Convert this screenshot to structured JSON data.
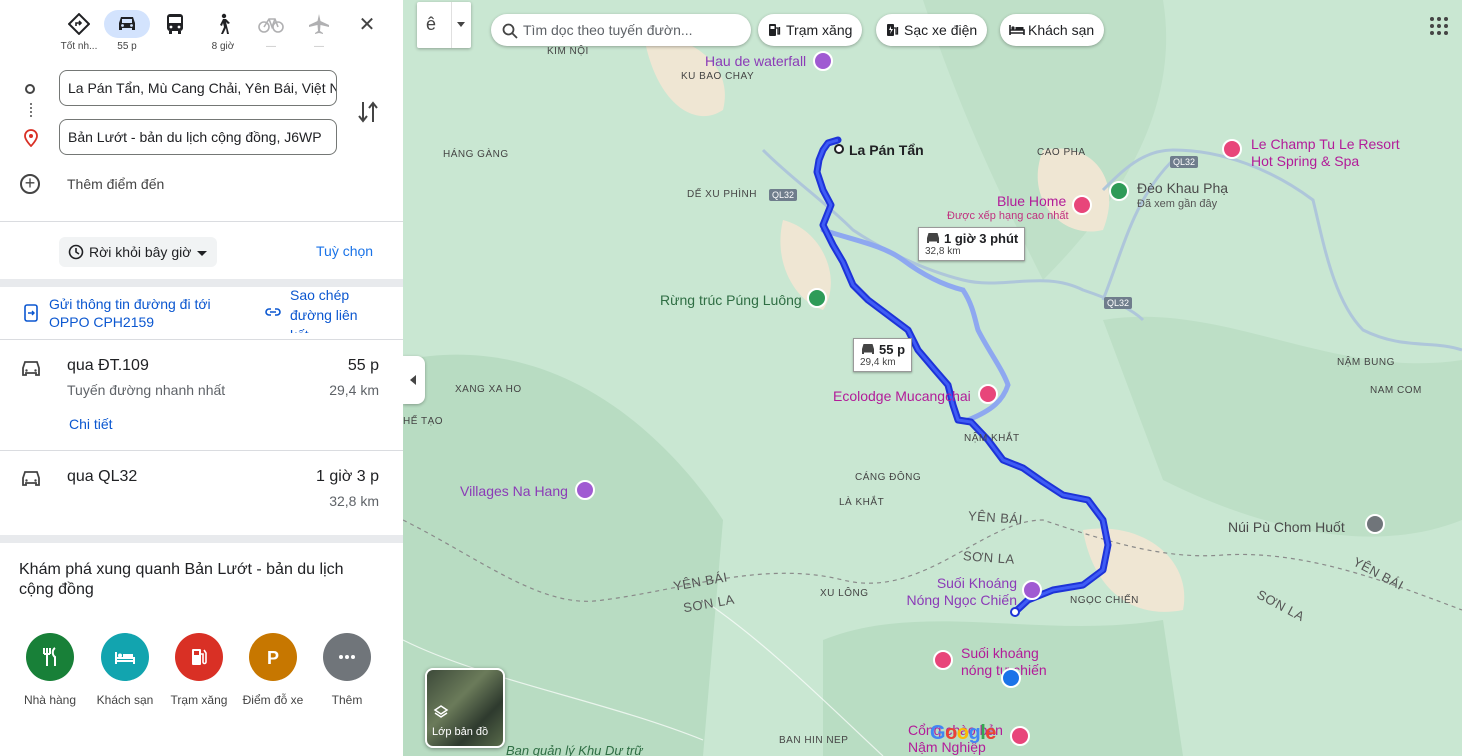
{
  "travel_modes": [
    {
      "name": "best",
      "sub": "Tốt nh...",
      "icon": "diamond-route-icon"
    },
    {
      "name": "driving",
      "sub": "55 p",
      "icon": "car-icon",
      "active": true
    },
    {
      "name": "transit",
      "sub": "",
      "icon": "bus-icon"
    },
    {
      "name": "walking",
      "sub": "8 giờ",
      "icon": "walking-icon"
    },
    {
      "name": "cycling",
      "sub": "—",
      "icon": "bike-icon"
    },
    {
      "name": "flight",
      "sub": "—",
      "icon": "plane-icon"
    }
  ],
  "origin": "La Pán Tẩn, Mù Cang Chải, Yên Bái, Việt Nam",
  "destination": "Bản Lướt - bản du lịch cộng đồng, J6WP",
  "add_destination": "Thêm điểm đến",
  "depart_label": "Rời khỏi bây giờ",
  "options_label": "Tuỳ chọn",
  "send_to_phone": "Gửi thông tin đường đi tới OPPO CPH2159",
  "copy_link": "Sao chép đường liên kết",
  "routes": [
    {
      "via": "qua ĐT.109",
      "note": "Tuyến đường nhanh nhất",
      "duration": "55 p",
      "distance": "29,4 km",
      "details": "Chi tiết"
    },
    {
      "via": "qua QL32",
      "duration": "1 giờ 3 p",
      "distance": "32,8 km"
    }
  ],
  "explore_title": "Khám phá xung quanh Bản Lướt - bản du lịch cộng đồng",
  "categories": [
    {
      "label": "Nhà hàng",
      "color": "#188038",
      "icon": "restaurant-icon"
    },
    {
      "label": "Khách sạn",
      "color": "#12a4af",
      "icon": "hotel-icon"
    },
    {
      "label": "Trạm xăng",
      "color": "#d93025",
      "icon": "gas-station-icon"
    },
    {
      "label": "Điểm đỗ xe",
      "color": "#c77700",
      "icon": "parking-icon"
    },
    {
      "label": "Thêm",
      "color": "#70757a",
      "icon": "more-icon"
    }
  ],
  "map": {
    "search_placeholder": "Tìm dọc theo tuyến đườn...",
    "lang_glyph": "ê",
    "chips": [
      "Trạm xăng",
      "Sạc xe điện",
      "Khách sạn"
    ],
    "start_label": "La Pán Tẩn",
    "route_boxes": [
      {
        "time": "1 giờ 3 phút",
        "distance": "32,8 km"
      },
      {
        "time": "55 p",
        "distance": "29,4 km"
      }
    ],
    "places": [
      "KIM NỘI",
      "KU BAO CHAY",
      "HÁNG GÀNG",
      "DẾ XU PHÌNH",
      "CAO PHA",
      "XANG XA HO",
      "HẾ TẠO",
      "NẬM KHẮT",
      "CÁNG ĐÔNG",
      "LÀ KHẮT",
      "XU LÔNG",
      "NGỌC CHIẾN",
      "NẬM BUNG",
      "NAM COM",
      "BAN HIN NEP"
    ],
    "admin_labels": [
      "YÊN BÁI",
      "SƠN LA",
      "YÊN BÁI",
      "SƠN LA",
      "YÊN BÁI",
      "SƠN LA"
    ],
    "road_labels": [
      "QL32",
      "QL32",
      "QL32"
    ],
    "pois": [
      {
        "name": "Hau de waterfall",
        "kind": "purple"
      },
      {
        "name": "Le Champ Tu Le Resort Hot Spring & Spa",
        "kind": "pink"
      },
      {
        "name": "Đèo Khau Phạ",
        "sub": "Đã xem gần đây",
        "kind": "green"
      },
      {
        "name": "Blue Home",
        "sub": "Được xếp hạng cao nhất",
        "kind": "pink"
      },
      {
        "name": "Rừng trúc Púng Luông",
        "kind": "green"
      },
      {
        "name": "Ecolodge Mucangchai",
        "kind": "pink"
      },
      {
        "name": "Villages Na Hang",
        "kind": "purple"
      },
      {
        "name": "Núi Pù Chom Huốt",
        "kind": "gray"
      },
      {
        "name": "Suối Khoáng Nóng Ngọc Chiến",
        "kind": "purple"
      },
      {
        "name": "Suối khoáng nóng tự chiến",
        "kind": "pink"
      },
      {
        "name": "Cổng chào bản Nậm Nghiệp",
        "kind": "pink"
      },
      {
        "name": "Ban quản lý Khu Dự trữ",
        "kind": "green"
      }
    ],
    "layer_label": "Lớp bản đồ",
    "logo": "Google"
  },
  "colors": {
    "route_main": "#1a33e6",
    "route_alt": "#8ea8f0",
    "accent": "#0b57d0"
  }
}
